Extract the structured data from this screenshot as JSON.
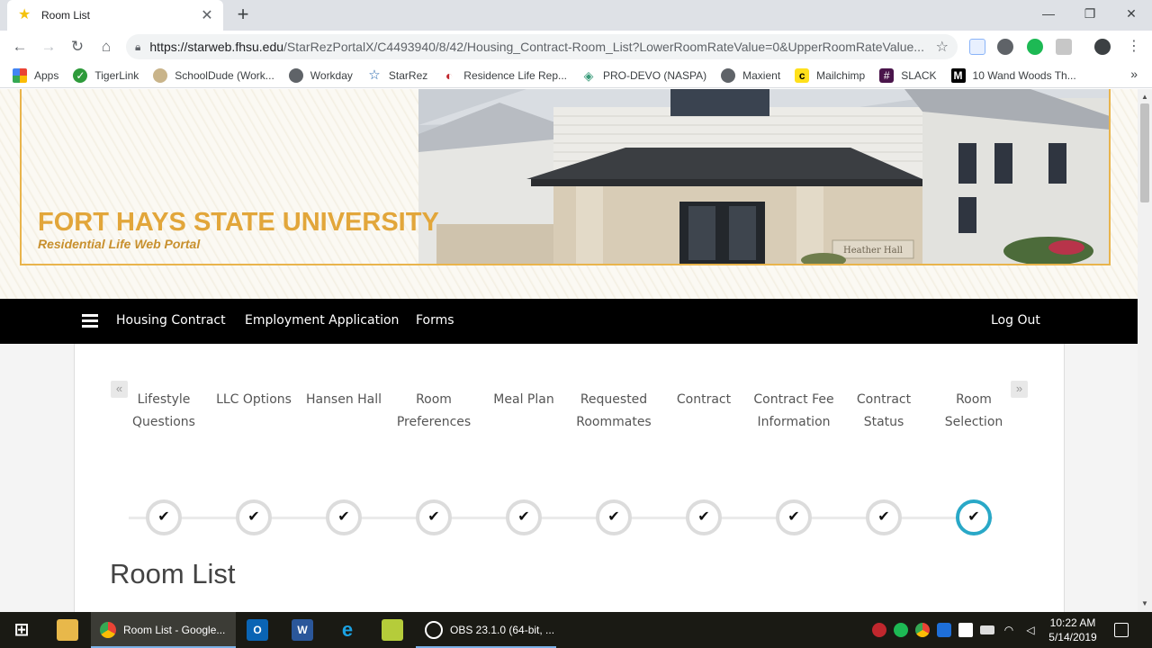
{
  "browser": {
    "tab_title": "Room List",
    "url_host": "https://starweb.fhsu.edu",
    "url_path": "/StarRezPortalX/C4493940/8/42/Housing_Contract-Room_List?LowerRoomRateValue=0&UpperRoomRateValue...",
    "bookmarks": [
      {
        "label": "Apps",
        "icon": "apps-grid-icon"
      },
      {
        "label": "TigerLink",
        "icon": "tigerlink-icon"
      },
      {
        "label": "SchoolDude (Work...",
        "icon": "schooldude-icon"
      },
      {
        "label": "Workday",
        "icon": "globe-icon"
      },
      {
        "label": "StarRez",
        "icon": "star-icon"
      },
      {
        "label": "Residence Life Rep...",
        "icon": "residence-life-icon"
      },
      {
        "label": "PRO-DEVO (NASPA)",
        "icon": "diamond-icon"
      },
      {
        "label": "Maxient",
        "icon": "globe-icon"
      },
      {
        "label": "Mailchimp",
        "icon": "mailchimp-icon"
      },
      {
        "label": "SLACK",
        "icon": "slack-icon"
      },
      {
        "label": "10 Wand Woods Th...",
        "icon": "medium-icon"
      }
    ]
  },
  "banner": {
    "title": "FORT HAYS STATE UNIVERSITY",
    "subtitle": "Residential Life Web Portal",
    "sign_text": "Heather Hall"
  },
  "nav": {
    "links": [
      "Housing Contract",
      "Employment Application",
      "Forms"
    ],
    "logout": "Log Out"
  },
  "steps": [
    {
      "label": "Lifestyle Questions",
      "done": true
    },
    {
      "label": "LLC Options",
      "done": true
    },
    {
      "label": "Hansen Hall",
      "done": true
    },
    {
      "label": "Room Preferences",
      "done": true
    },
    {
      "label": "Meal Plan",
      "done": true
    },
    {
      "label": "Requested Roommates",
      "done": true
    },
    {
      "label": "Contract",
      "done": true
    },
    {
      "label": "Contract Fee Information",
      "done": true
    },
    {
      "label": "Contract Status",
      "done": true
    },
    {
      "label": "Room Selection",
      "active": true
    }
  ],
  "page": {
    "heading": "Room List"
  },
  "taskbar": {
    "apps": [
      {
        "label": "Room List - Google...",
        "icon": "chrome-icon"
      },
      {
        "label": "OBS 23.1.0 (64-bit, ...",
        "icon": "obs-icon"
      }
    ],
    "time": "10:22 AM",
    "date": "5/14/2019"
  },
  "colors": {
    "accent_gold": "#e2a63a",
    "active_step": "#29a8c7",
    "nav_bg": "#000000"
  }
}
